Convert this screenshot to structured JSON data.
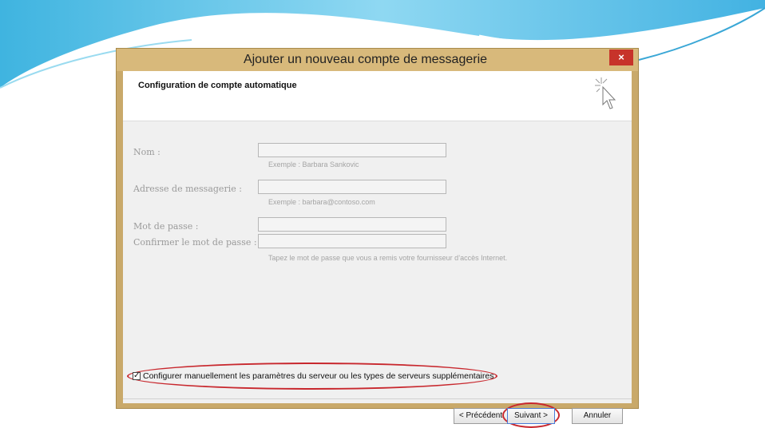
{
  "dialog": {
    "title": "Ajouter un nouveau compte de messagerie",
    "close_symbol": "×",
    "header_title": "Configuration de compte automatique",
    "header_icon": "cursor-sparkle-icon"
  },
  "form": {
    "name_label": "Nom :",
    "name_value": "",
    "name_hint": "Exemple : Barbara Sankovic",
    "email_label": "Adresse de messagerie :",
    "email_value": "",
    "email_hint": "Exemple : barbara@contoso.com",
    "password_label": "Mot de passe :",
    "password_value": "",
    "confirm_label": "Confirmer le mot de passe :",
    "confirm_value": "",
    "password_hint": "Tapez le mot de passe que vous a remis votre fournisseur d’accès Internet."
  },
  "manual_config": {
    "checked": true,
    "check_mark": "✓",
    "label": "Configurer manuellement les paramètres du serveur ou les types de serveurs supplémentaires"
  },
  "buttons": {
    "previous": "< Précédent",
    "next": "Suivant >",
    "cancel": "Annuler"
  },
  "colors": {
    "highlight": "#c8282e",
    "swoosh": "#5cc6e6",
    "close": "#c7332a"
  }
}
